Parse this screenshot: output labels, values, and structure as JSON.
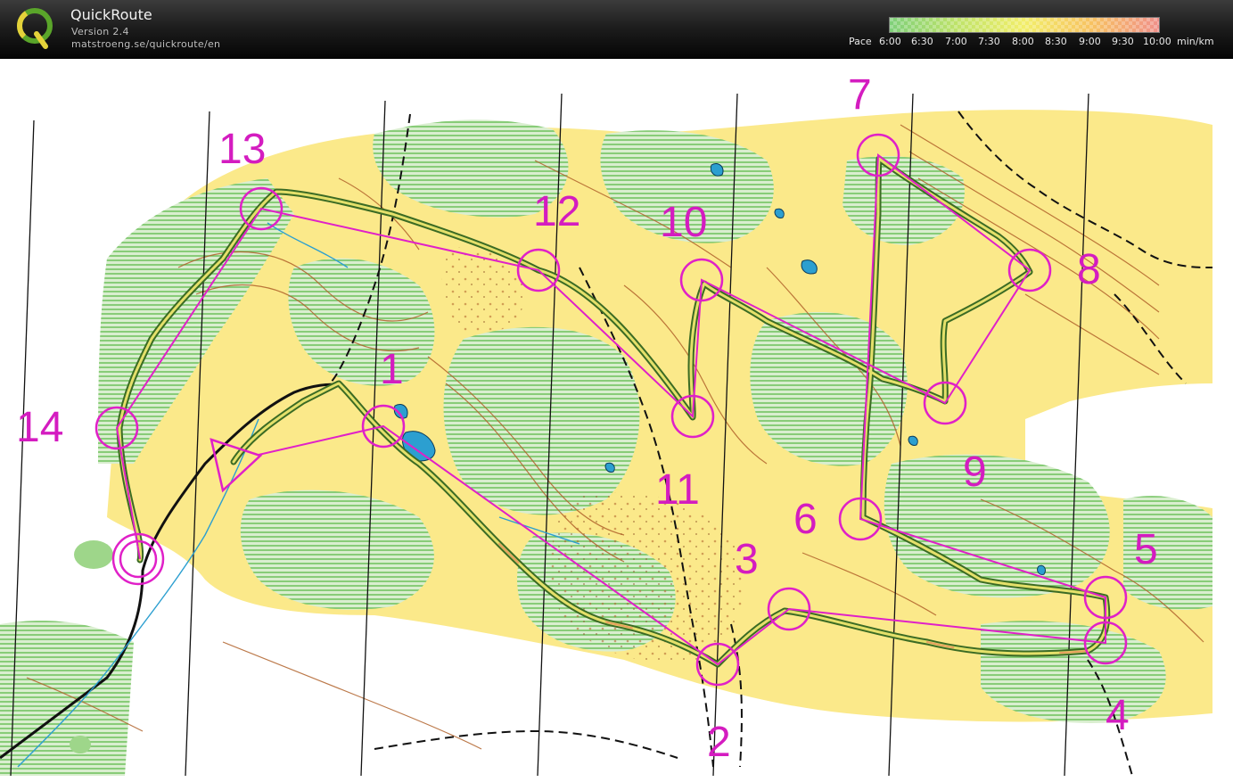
{
  "header": {
    "app_name": "QuickRoute",
    "version": "Version 2.4",
    "url": "matstroeng.se/quickroute/en"
  },
  "logo": {
    "letter": "Q",
    "icon": "quickroute-logo-icon"
  },
  "pace_legend": {
    "label": "Pace",
    "ticks": [
      "6:00",
      "6:30",
      "7:00",
      "7:30",
      "8:00",
      "8:30",
      "9:00",
      "9:30",
      "10:00"
    ],
    "unit": "min/km",
    "colors": [
      "#7fd07a",
      "#bfe36a",
      "#f2ee6a",
      "#f7c262",
      "#f0908a"
    ]
  },
  "map": {
    "colors": {
      "paper": "#ffffff",
      "open_land": "#fbe98a",
      "forest_green": "#9cd28a",
      "course": "#e020c8",
      "route_outer": "#3b6b24",
      "route_inner": "#e4e06a",
      "contour": "#b0612a",
      "water": "#2c9fd0"
    },
    "start_symbol": "start-triangle",
    "finish_symbol": "finish-double-circle",
    "controls": [
      {
        "label": "1"
      },
      {
        "label": "2"
      },
      {
        "label": "3"
      },
      {
        "label": "4"
      },
      {
        "label": "5"
      },
      {
        "label": "6"
      },
      {
        "label": "7"
      },
      {
        "label": "8"
      },
      {
        "label": "9"
      },
      {
        "label": "10"
      },
      {
        "label": "11"
      },
      {
        "label": "12"
      },
      {
        "label": "13"
      },
      {
        "label": "14"
      }
    ]
  }
}
